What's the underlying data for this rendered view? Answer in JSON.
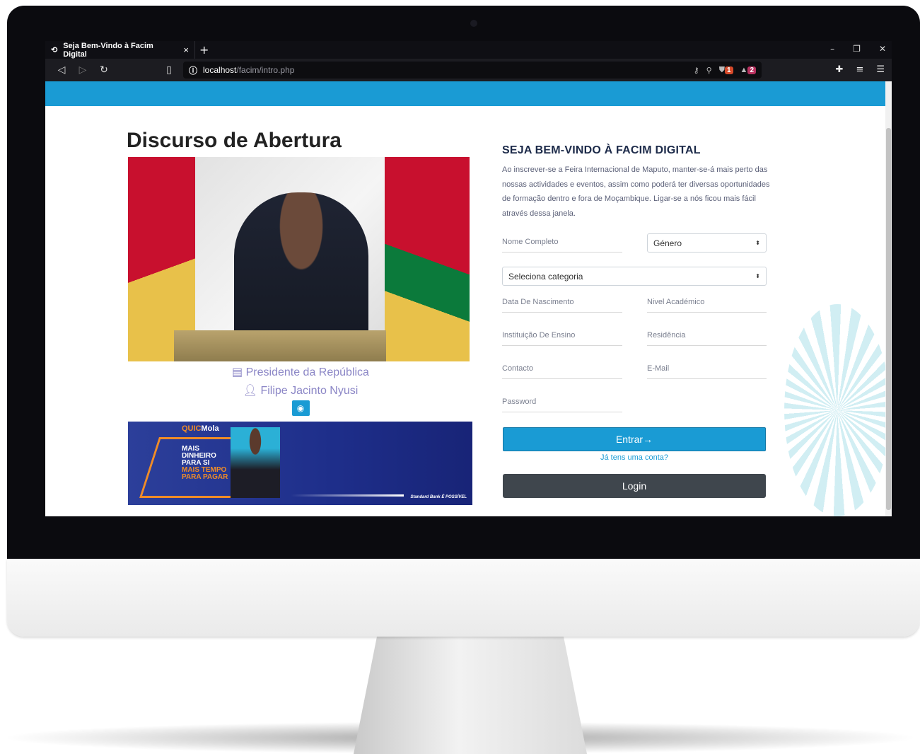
{
  "browser": {
    "tab_title": "Seja Bem-Vindo à Facim Digital",
    "tab_close": "×",
    "new_tab": "+",
    "url_host": "localhost",
    "url_path": "/facim/intro.php",
    "shield_badge": "1",
    "alert_badge": "2",
    "window_controls": [
      "–",
      "❐",
      "✕"
    ]
  },
  "page": {
    "left_title": "Discurso de Abertura",
    "photo_caption_role": "Presidente da República",
    "photo_caption_name": "Filipe Jacinto Nyusi",
    "ad": {
      "brand_a": "QUIC",
      "brand_b": "Mola",
      "line1": "MAIS",
      "line2": "DINHEIRO",
      "line3": "PARA SI",
      "line4": "MAIS TEMPO",
      "line5": "PARA PAGAR",
      "footer": "Standard Bank  É POSSÍVEL"
    },
    "form": {
      "title": "SEJA BEM-VINDO À FACIM DIGITAL",
      "description": "Ao inscrever-se a Feira Internacional de Maputo, manter-se-á mais perto das nossas actividades e eventos, assim como poderá ter diversas oportunidades de formação dentro e fora de Moçambique. Ligar-se a nós ficou mais fácil através dessa janela.",
      "nome": "Nome Completo",
      "genero": "Género",
      "categoria": "Seleciona categoria",
      "nascimento": "Data De Nascimento",
      "nivel": "Nivel Académico",
      "instituicao": "Instituição De Ensino",
      "residencia": "Residência",
      "contacto": "Contacto",
      "email": "E-Mail",
      "password": "Password",
      "entrar": "Entrar→",
      "link": "Já tens uma conta?",
      "login": "Login"
    }
  },
  "colors": {
    "accent": "#1a9bd4",
    "dark_button": "#3f464d",
    "title": "#1c2a49"
  }
}
